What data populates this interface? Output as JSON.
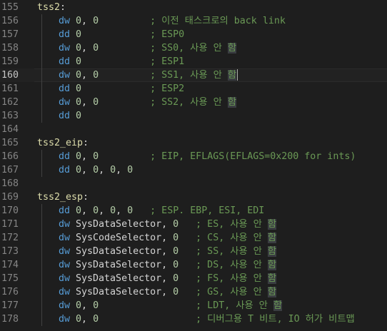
{
  "editor": {
    "active_line": 160,
    "lines": [
      {
        "n": "155",
        "indent": 0,
        "segments": [
          {
            "c": "lbl",
            "t": "tss2"
          },
          {
            "c": "txt",
            "t": ":"
          }
        ]
      },
      {
        "n": "156",
        "indent": 1,
        "segments": [
          {
            "c": "kw",
            "t": "dw"
          },
          {
            "c": "txt",
            "t": " "
          },
          {
            "c": "num",
            "t": "0"
          },
          {
            "c": "txt",
            "t": ", "
          },
          {
            "c": "num",
            "t": "0"
          },
          {
            "c": "txt",
            "t": "         "
          },
          {
            "c": "cmt",
            "t": "; 이전 태스크로의 back link"
          }
        ]
      },
      {
        "n": "157",
        "indent": 1,
        "segments": [
          {
            "c": "kw",
            "t": "dd"
          },
          {
            "c": "txt",
            "t": " "
          },
          {
            "c": "num",
            "t": "0"
          },
          {
            "c": "txt",
            "t": "            "
          },
          {
            "c": "cmt",
            "t": "; ESP0"
          }
        ]
      },
      {
        "n": "158",
        "indent": 1,
        "segments": [
          {
            "c": "kw",
            "t": "dw"
          },
          {
            "c": "txt",
            "t": " "
          },
          {
            "c": "num",
            "t": "0"
          },
          {
            "c": "txt",
            "t": ", "
          },
          {
            "c": "num",
            "t": "0"
          },
          {
            "c": "txt",
            "t": "         "
          },
          {
            "c": "cmt",
            "t": "; SS0, 사용 안 "
          },
          {
            "c": "cmt hl",
            "t": "함"
          }
        ]
      },
      {
        "n": "159",
        "indent": 1,
        "segments": [
          {
            "c": "kw",
            "t": "dd"
          },
          {
            "c": "txt",
            "t": " "
          },
          {
            "c": "num",
            "t": "0"
          },
          {
            "c": "txt",
            "t": "            "
          },
          {
            "c": "cmt",
            "t": "; ESP1"
          }
        ]
      },
      {
        "n": "160",
        "indent": 1,
        "cursor": true,
        "segments": [
          {
            "c": "kw",
            "t": "dw"
          },
          {
            "c": "txt",
            "t": " "
          },
          {
            "c": "num",
            "t": "0"
          },
          {
            "c": "txt",
            "t": ", "
          },
          {
            "c": "num",
            "t": "0"
          },
          {
            "c": "txt",
            "t": "         "
          },
          {
            "c": "cmt",
            "t": "; SS1, 사용 안 "
          },
          {
            "c": "cmt hl",
            "t": "함"
          }
        ]
      },
      {
        "n": "161",
        "indent": 1,
        "segments": [
          {
            "c": "kw",
            "t": "dd"
          },
          {
            "c": "txt",
            "t": " "
          },
          {
            "c": "num",
            "t": "0"
          },
          {
            "c": "txt",
            "t": "            "
          },
          {
            "c": "cmt",
            "t": "; ESP2"
          }
        ]
      },
      {
        "n": "162",
        "indent": 1,
        "segments": [
          {
            "c": "kw",
            "t": "dw"
          },
          {
            "c": "txt",
            "t": " "
          },
          {
            "c": "num",
            "t": "0"
          },
          {
            "c": "txt",
            "t": ", "
          },
          {
            "c": "num",
            "t": "0"
          },
          {
            "c": "txt",
            "t": "         "
          },
          {
            "c": "cmt",
            "t": "; SS2, 사용 안 "
          },
          {
            "c": "cmt hl",
            "t": "함"
          }
        ]
      },
      {
        "n": "163",
        "indent": 1,
        "segments": [
          {
            "c": "kw",
            "t": "dd"
          },
          {
            "c": "txt",
            "t": " "
          },
          {
            "c": "num",
            "t": "0"
          }
        ]
      },
      {
        "n": "164",
        "indent": 0,
        "segments": []
      },
      {
        "n": "165",
        "indent": 0,
        "segments": [
          {
            "c": "lbl",
            "t": "tss2_eip"
          },
          {
            "c": "txt",
            "t": ":"
          }
        ]
      },
      {
        "n": "166",
        "indent": 1,
        "segments": [
          {
            "c": "kw",
            "t": "dd"
          },
          {
            "c": "txt",
            "t": " "
          },
          {
            "c": "num",
            "t": "0"
          },
          {
            "c": "txt",
            "t": ", "
          },
          {
            "c": "num",
            "t": "0"
          },
          {
            "c": "txt",
            "t": "         "
          },
          {
            "c": "cmt",
            "t": "; EIP, EFLAGS(EFLAGS=0x200 for ints)"
          }
        ]
      },
      {
        "n": "167",
        "indent": 1,
        "segments": [
          {
            "c": "kw",
            "t": "dd"
          },
          {
            "c": "txt",
            "t": " "
          },
          {
            "c": "num",
            "t": "0"
          },
          {
            "c": "txt",
            "t": ", "
          },
          {
            "c": "num",
            "t": "0"
          },
          {
            "c": "txt",
            "t": ", "
          },
          {
            "c": "num",
            "t": "0"
          },
          {
            "c": "txt",
            "t": ", "
          },
          {
            "c": "num",
            "t": "0"
          }
        ]
      },
      {
        "n": "168",
        "indent": 0,
        "segments": []
      },
      {
        "n": "169",
        "indent": 0,
        "segments": [
          {
            "c": "lbl",
            "t": "tss2_esp"
          },
          {
            "c": "txt",
            "t": ":"
          }
        ]
      },
      {
        "n": "170",
        "indent": 1,
        "segments": [
          {
            "c": "kw",
            "t": "dd"
          },
          {
            "c": "txt",
            "t": " "
          },
          {
            "c": "num",
            "t": "0"
          },
          {
            "c": "txt",
            "t": ", "
          },
          {
            "c": "num",
            "t": "0"
          },
          {
            "c": "txt",
            "t": ", "
          },
          {
            "c": "num",
            "t": "0"
          },
          {
            "c": "txt",
            "t": ", "
          },
          {
            "c": "num",
            "t": "0"
          },
          {
            "c": "txt",
            "t": "   "
          },
          {
            "c": "cmt",
            "t": "; ESP. EBP, ESI, EDI"
          }
        ]
      },
      {
        "n": "171",
        "indent": 1,
        "segments": [
          {
            "c": "kw",
            "t": "dw"
          },
          {
            "c": "txt",
            "t": " SysDataSelector, "
          },
          {
            "c": "num",
            "t": "0"
          },
          {
            "c": "txt",
            "t": "   "
          },
          {
            "c": "cmt",
            "t": "; ES, 사용 안 "
          },
          {
            "c": "cmt hl",
            "t": "함"
          }
        ]
      },
      {
        "n": "172",
        "indent": 1,
        "segments": [
          {
            "c": "kw",
            "t": "dw"
          },
          {
            "c": "txt",
            "t": " SysCodeSelector, "
          },
          {
            "c": "num",
            "t": "0"
          },
          {
            "c": "txt",
            "t": "   "
          },
          {
            "c": "cmt",
            "t": "; CS, 사용 안 "
          },
          {
            "c": "cmt hl",
            "t": "함"
          }
        ]
      },
      {
        "n": "173",
        "indent": 1,
        "segments": [
          {
            "c": "kw",
            "t": "dw"
          },
          {
            "c": "txt",
            "t": " SysDataSelector, "
          },
          {
            "c": "num",
            "t": "0"
          },
          {
            "c": "txt",
            "t": "   "
          },
          {
            "c": "cmt",
            "t": "; SS, 사용 안 "
          },
          {
            "c": "cmt hl",
            "t": "함"
          }
        ]
      },
      {
        "n": "174",
        "indent": 1,
        "segments": [
          {
            "c": "kw",
            "t": "dw"
          },
          {
            "c": "txt",
            "t": " SysDataSelector, "
          },
          {
            "c": "num",
            "t": "0"
          },
          {
            "c": "txt",
            "t": "   "
          },
          {
            "c": "cmt",
            "t": "; DS, 사용 안 "
          },
          {
            "c": "cmt hl",
            "t": "함"
          }
        ]
      },
      {
        "n": "175",
        "indent": 1,
        "segments": [
          {
            "c": "kw",
            "t": "dw"
          },
          {
            "c": "txt",
            "t": " SysDataSelector, "
          },
          {
            "c": "num",
            "t": "0"
          },
          {
            "c": "txt",
            "t": "   "
          },
          {
            "c": "cmt",
            "t": "; FS, 사용 안 "
          },
          {
            "c": "cmt hl",
            "t": "함"
          }
        ]
      },
      {
        "n": "176",
        "indent": 1,
        "segments": [
          {
            "c": "kw",
            "t": "dw"
          },
          {
            "c": "txt",
            "t": " SysDataSelector, "
          },
          {
            "c": "num",
            "t": "0"
          },
          {
            "c": "txt",
            "t": "   "
          },
          {
            "c": "cmt",
            "t": "; GS, 사용 안 "
          },
          {
            "c": "cmt hl",
            "t": "함"
          }
        ]
      },
      {
        "n": "177",
        "indent": 1,
        "segments": [
          {
            "c": "kw",
            "t": "dw"
          },
          {
            "c": "txt",
            "t": " "
          },
          {
            "c": "num",
            "t": "0"
          },
          {
            "c": "txt",
            "t": ", "
          },
          {
            "c": "num",
            "t": "0"
          },
          {
            "c": "txt",
            "t": "                 "
          },
          {
            "c": "cmt",
            "t": "; LDT, 사용 안 "
          },
          {
            "c": "cmt hl",
            "t": "함"
          }
        ]
      },
      {
        "n": "178",
        "indent": 1,
        "segments": [
          {
            "c": "kw",
            "t": "dw"
          },
          {
            "c": "txt",
            "t": " "
          },
          {
            "c": "num",
            "t": "0"
          },
          {
            "c": "txt",
            "t": ", "
          },
          {
            "c": "num",
            "t": "0"
          },
          {
            "c": "txt",
            "t": "                 "
          },
          {
            "c": "cmt",
            "t": "; 디버그용 T 비트, IO 허가 비트맵"
          }
        ]
      }
    ]
  }
}
